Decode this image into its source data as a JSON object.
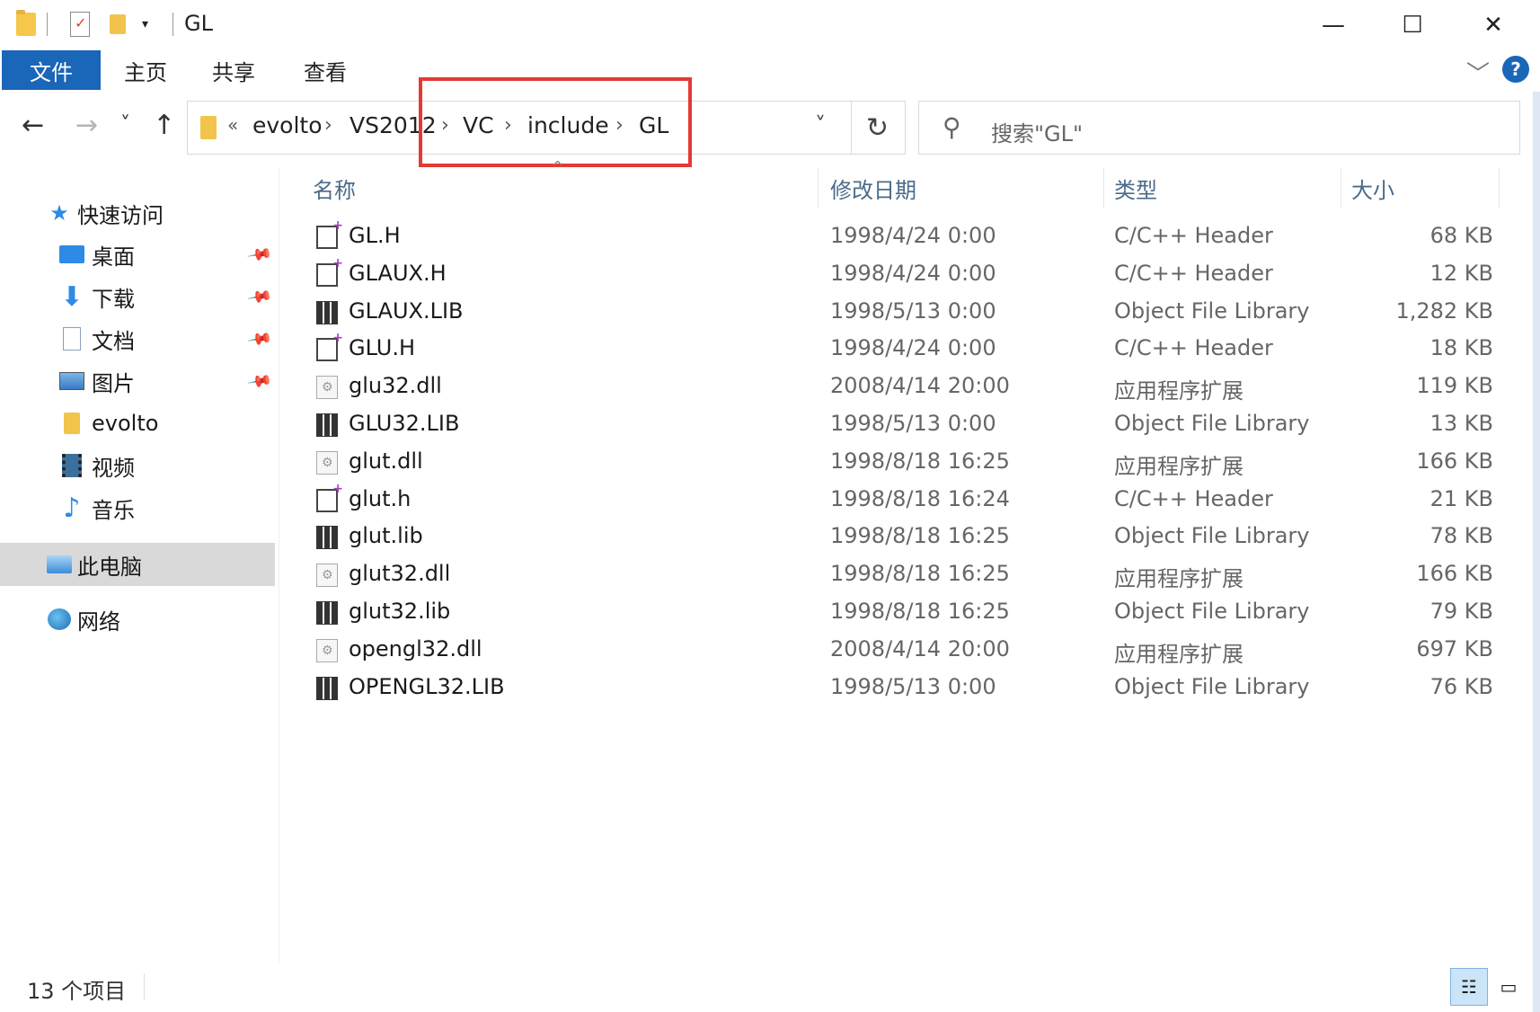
{
  "window": {
    "title": "GL",
    "minimize": "—",
    "maximize": "☐",
    "close": "✕"
  },
  "ribbon": {
    "file_tab": "文件",
    "tabs": [
      "主页",
      "共享",
      "查看"
    ],
    "expand": "﹀",
    "help": "?"
  },
  "nav": {
    "back": "←",
    "forward": "→",
    "recent": "˅",
    "up": "↑",
    "overflow": "«",
    "breadcrumbs": [
      "evolto",
      "VS2012",
      "VC",
      "include",
      "GL"
    ],
    "breadcrumb_sep": "›",
    "dropdown": "˅",
    "refresh": "↻",
    "search_placeholder": "搜索\"GL\""
  },
  "sidebar": {
    "quick_access": "快速访问",
    "items": [
      {
        "label": "桌面",
        "icon": "desktop-icon",
        "pinned": true
      },
      {
        "label": "下载",
        "icon": "download-icon",
        "pinned": true
      },
      {
        "label": "文档",
        "icon": "document-icon",
        "pinned": true
      },
      {
        "label": "图片",
        "icon": "pictures-icon",
        "pinned": true
      },
      {
        "label": "evolto",
        "icon": "folder-icon",
        "pinned": false
      },
      {
        "label": "视频",
        "icon": "video-icon",
        "pinned": false
      },
      {
        "label": "音乐",
        "icon": "music-icon",
        "pinned": false
      }
    ],
    "this_pc": "此电脑",
    "network": "网络",
    "pin_glyph": "📌"
  },
  "list": {
    "columns": {
      "name": "名称",
      "date": "修改日期",
      "type": "类型",
      "size": "大小"
    },
    "sort_caret": "^",
    "files": [
      {
        "name": "GL.H",
        "date": "1998/4/24 0:00",
        "type": "C/C++ Header",
        "size": "68 KB",
        "kind": "h"
      },
      {
        "name": "GLAUX.H",
        "date": "1998/4/24 0:00",
        "type": "C/C++ Header",
        "size": "12 KB",
        "kind": "h"
      },
      {
        "name": "GLAUX.LIB",
        "date": "1998/5/13 0:00",
        "type": "Object File Library",
        "size": "1,282 KB",
        "kind": "lib"
      },
      {
        "name": "GLU.H",
        "date": "1998/4/24 0:00",
        "type": "C/C++ Header",
        "size": "18 KB",
        "kind": "h"
      },
      {
        "name": "glu32.dll",
        "date": "2008/4/14 20:00",
        "type": "应用程序扩展",
        "size": "119 KB",
        "kind": "dll"
      },
      {
        "name": "GLU32.LIB",
        "date": "1998/5/13 0:00",
        "type": "Object File Library",
        "size": "13 KB",
        "kind": "lib"
      },
      {
        "name": "glut.dll",
        "date": "1998/8/18 16:25",
        "type": "应用程序扩展",
        "size": "166 KB",
        "kind": "dll"
      },
      {
        "name": "glut.h",
        "date": "1998/8/18 16:24",
        "type": "C/C++ Header",
        "size": "21 KB",
        "kind": "h"
      },
      {
        "name": "glut.lib",
        "date": "1998/8/18 16:25",
        "type": "Object File Library",
        "size": "78 KB",
        "kind": "lib"
      },
      {
        "name": "glut32.dll",
        "date": "1998/8/18 16:25",
        "type": "应用程序扩展",
        "size": "166 KB",
        "kind": "dll"
      },
      {
        "name": "glut32.lib",
        "date": "1998/8/18 16:25",
        "type": "Object File Library",
        "size": "79 KB",
        "kind": "lib"
      },
      {
        "name": "opengl32.dll",
        "date": "2008/4/14 20:00",
        "type": "应用程序扩展",
        "size": "697 KB",
        "kind": "dll"
      },
      {
        "name": "OPENGL32.LIB",
        "date": "1998/5/13 0:00",
        "type": "Object File Library",
        "size": "76 KB",
        "kind": "lib"
      }
    ]
  },
  "status": {
    "count": "13 个项目",
    "details_view": "☷",
    "thumb_view": "▭"
  },
  "colors": {
    "accent": "#1a66b8",
    "highlight_box": "#e53935",
    "selected_bg": "#d9d9d9"
  }
}
